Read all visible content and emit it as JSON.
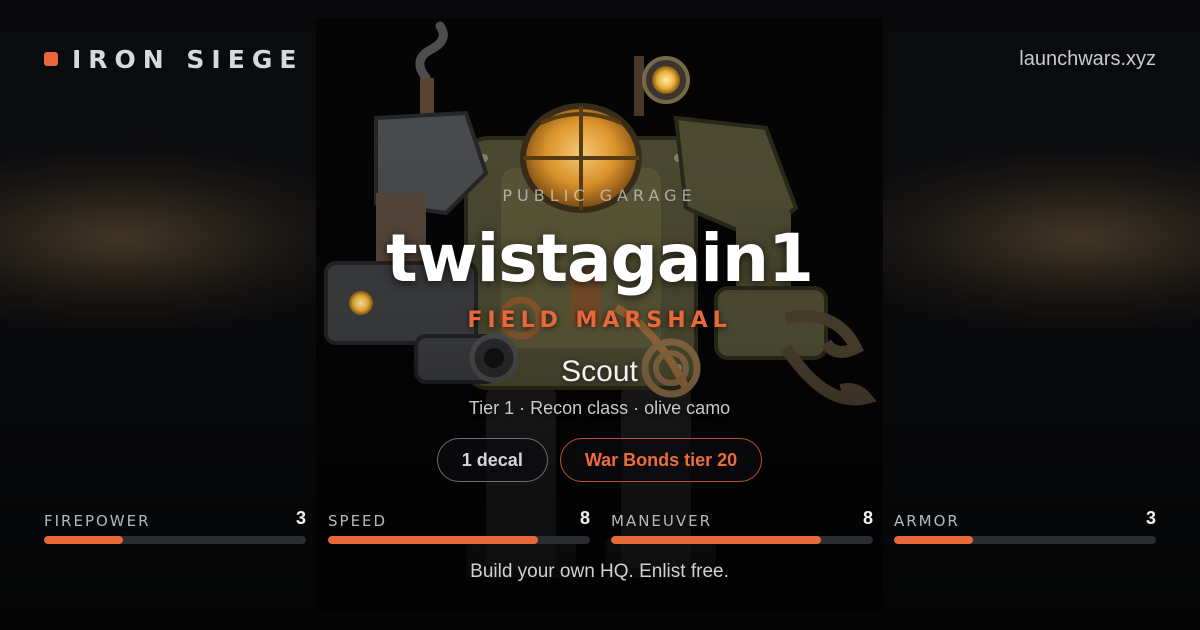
{
  "brand": {
    "name": "IRON SIEGE",
    "accent_color": "#e8683a"
  },
  "site_url": "launchwars.xyz",
  "card": {
    "eyebrow": "PUBLIC GARAGE",
    "username": "twistagain1",
    "rank": "FIELD MARSHAL",
    "mech_name": "Scout",
    "mech_subtitle": "Tier 1 · Recon class · olive camo"
  },
  "badges": [
    {
      "label": "1 decal",
      "style": "grey"
    },
    {
      "label": "War Bonds tier 20",
      "style": "accent"
    }
  ],
  "stats": {
    "scale_max": 10,
    "items": [
      {
        "label": "FIREPOWER",
        "value": 3
      },
      {
        "label": "SPEED",
        "value": 8
      },
      {
        "label": "MANEUVER",
        "value": 8
      },
      {
        "label": "ARMOR",
        "value": 3
      }
    ]
  },
  "cta": "Build your own HQ. Enlist free.",
  "art": {
    "subject": "steampunk mech robot illustration",
    "icon": "mech-artwork"
  }
}
